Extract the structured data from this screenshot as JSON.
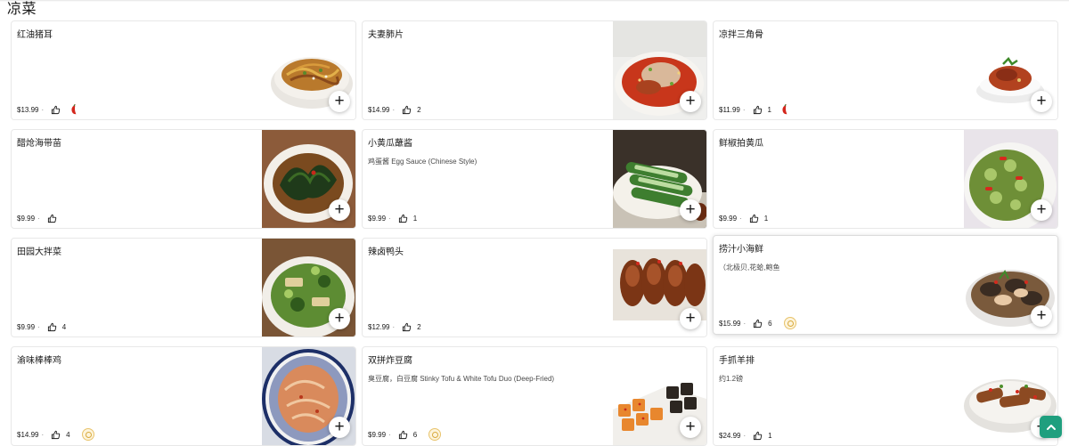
{
  "section": {
    "title": "凉菜"
  },
  "items": [
    {
      "name": "红油猪耳",
      "desc": "",
      "price": "$13.99",
      "likes": "",
      "spicy": true,
      "badge": false,
      "raised": false,
      "photo": "noodle-plate"
    },
    {
      "name": "夫妻肺片",
      "desc": "",
      "price": "$14.99",
      "likes": "2",
      "spicy": false,
      "badge": false,
      "raised": false,
      "photo": "red-oil-plate"
    },
    {
      "name": "凉拌三角骨",
      "desc": "",
      "price": "$11.99",
      "likes": "1",
      "spicy": true,
      "badge": false,
      "raised": false,
      "photo": "small-bowl"
    },
    {
      "name": "醋炝海带苗",
      "desc": "",
      "price": "$9.99",
      "likes": "",
      "spicy": false,
      "badge": false,
      "raised": false,
      "photo": "seaweed-plate"
    },
    {
      "name": "小黄瓜蘸酱",
      "desc": "鸡蛋酱 Egg Sauce (Chinese Style)",
      "price": "$9.99",
      "likes": "1",
      "spicy": false,
      "badge": false,
      "raised": false,
      "photo": "cucumber-sticks"
    },
    {
      "name": "鲜椒拍黄瓜",
      "desc": "",
      "price": "$9.99",
      "likes": "1",
      "spicy": false,
      "badge": false,
      "raised": false,
      "photo": "cucumber-salad"
    },
    {
      "name": "田园大拌菜",
      "desc": "",
      "price": "$9.99",
      "likes": "4",
      "spicy": false,
      "badge": false,
      "raised": false,
      "photo": "green-salad"
    },
    {
      "name": "辣卤鸭头",
      "desc": "",
      "price": "$12.99",
      "likes": "2",
      "spicy": false,
      "badge": false,
      "raised": false,
      "photo": "duck-heads"
    },
    {
      "name": "捞汁小海鲜",
      "desc": "（北极贝,花蛤,鲍鱼",
      "price": "$15.99",
      "likes": "6",
      "spicy": false,
      "badge": true,
      "raised": true,
      "photo": "seafood-plate"
    },
    {
      "name": "渝味棒棒鸡",
      "desc": "",
      "price": "$14.99",
      "likes": "4",
      "spicy": false,
      "badge": true,
      "raised": false,
      "photo": "chicken-blue-bowl"
    },
    {
      "name": "双拼炸豆腐",
      "desc": "臭豆腐，白豆腐 Stinky Tofu & White Tofu Duo (Deep-Fried)",
      "price": "$9.99",
      "likes": "6",
      "spicy": false,
      "badge": true,
      "raised": false,
      "photo": "fried-tofu"
    },
    {
      "name": "手抓羊排",
      "desc": "约1.2磅",
      "price": "$24.99",
      "likes": "1",
      "spicy": false,
      "badge": false,
      "raised": false,
      "photo": "lamb-chops"
    }
  ],
  "add_button_label": "+",
  "colors": {
    "accent": "#1f9f7e",
    "chili": "#d4261c",
    "badge": "#e8c36b"
  }
}
